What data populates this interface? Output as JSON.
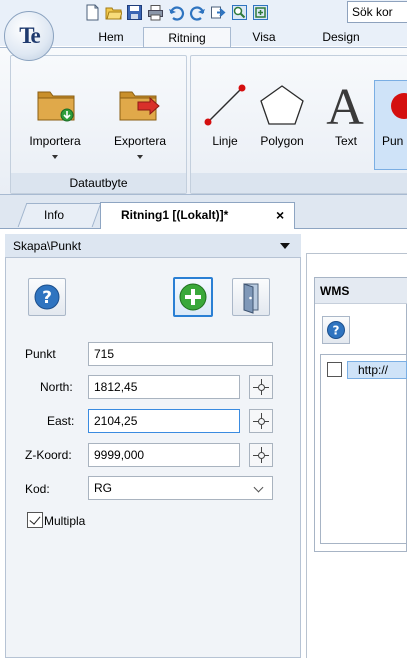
{
  "app": {
    "logo_text": "Te"
  },
  "quick_access": {
    "search_value": "Sök kor",
    "icons": [
      "new-document-icon",
      "open-folder-icon",
      "save-icon",
      "print-icon",
      "undo-icon",
      "redo-icon",
      "export-icon",
      "zoom-window-icon",
      "zoom-extent-icon"
    ]
  },
  "ribbon": {
    "tabs": [
      "Hem",
      "Ritning",
      "Visa",
      "Design"
    ],
    "active_tab": "Ritning",
    "groups": {
      "data": {
        "label": "Datautbyte",
        "buttons": [
          {
            "label": "Importera",
            "icon": "import-folder-icon"
          },
          {
            "label": "Exportera",
            "icon": "export-folder-icon"
          }
        ]
      },
      "draw": {
        "buttons": [
          {
            "label": "Linje",
            "icon": "line-icon"
          },
          {
            "label": "Polygon",
            "icon": "polygon-icon"
          },
          {
            "label": "Text",
            "icon": "text-icon"
          },
          {
            "label": "Pun",
            "icon": "point-icon"
          }
        ]
      }
    }
  },
  "doc_tabs": {
    "info_label": "Info",
    "doc_label": "Ritning1 [(Lokalt)]*",
    "close_glyph": "×"
  },
  "panel": {
    "title": "Skapa\\Punkt",
    "fields": {
      "punkt": {
        "label": "Punkt",
        "value": "715"
      },
      "north": {
        "label": "North:",
        "value": "1812,45"
      },
      "east": {
        "label": "East:",
        "value": "2104,25"
      },
      "z": {
        "label": "Z-Koord:",
        "value": "9999,000"
      },
      "kod": {
        "label": "Kod:",
        "value": "RG"
      }
    },
    "multipla": {
      "label": "Multipla",
      "checked": true
    }
  },
  "wms": {
    "title": "WMS",
    "url_item": "http://"
  },
  "colors": {
    "accent_blue": "#2a7fd4",
    "help_blue": "#2f74c0",
    "add_green": "#3aa83a",
    "point_red": "#d40f0f"
  }
}
